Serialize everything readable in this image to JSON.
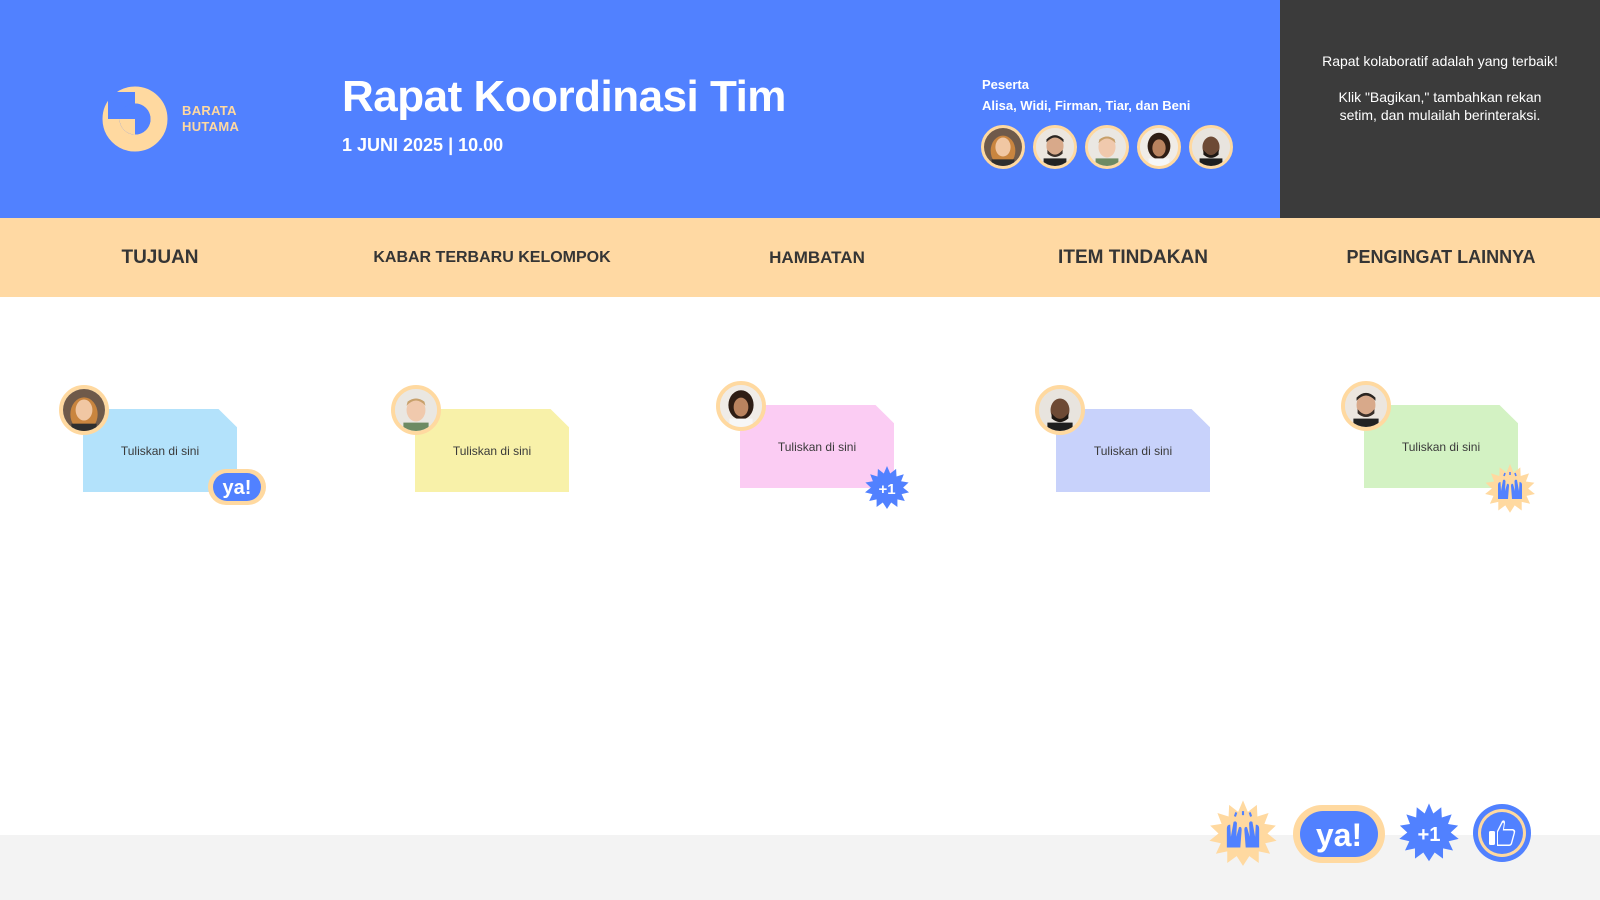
{
  "brand": {
    "line1": "BARATA",
    "line2": "HUTAMA"
  },
  "header": {
    "title": "Rapat Koordinasi Tim",
    "date": "1 JUNI 2025 | 10.00",
    "participants_label": "Peserta",
    "participants_names": "Alisa, Widi, Firman, Tiar, dan Beni"
  },
  "side_panel": {
    "line1": "Rapat kolaboratif adalah yang terbaik!",
    "line2": "Klik \"Bagikan,\" tambahkan rekan setim, dan mulailah berinteraksi."
  },
  "categories": [
    "TUJUAN",
    "KABAR TERBARU KELOMPOK",
    "HAMBATAN",
    "ITEM TINDAKAN",
    "PENGINGAT LAINNYA"
  ],
  "notes": [
    {
      "text": "Tuliskan di sini",
      "color": "#b3e2fb"
    },
    {
      "text": "Tuliskan di sini",
      "color": "#f8f1a9"
    },
    {
      "text": "Tuliskan di sini",
      "color": "#fbccf3"
    },
    {
      "text": "Tuliskan di sini",
      "color": "#c8d2fb"
    },
    {
      "text": "Tuliskan di sini",
      "color": "#d3f2c3"
    }
  ],
  "stickers": {
    "ya_text": "ya!",
    "plus_one_text": "+1"
  },
  "colors": {
    "header_bg": "#5181ff",
    "panel_bg": "#3b3b3b",
    "category_bg": "#ffd9a3",
    "accent_peach": "#ffd9a0",
    "footer_bg": "#f3f3f3"
  }
}
